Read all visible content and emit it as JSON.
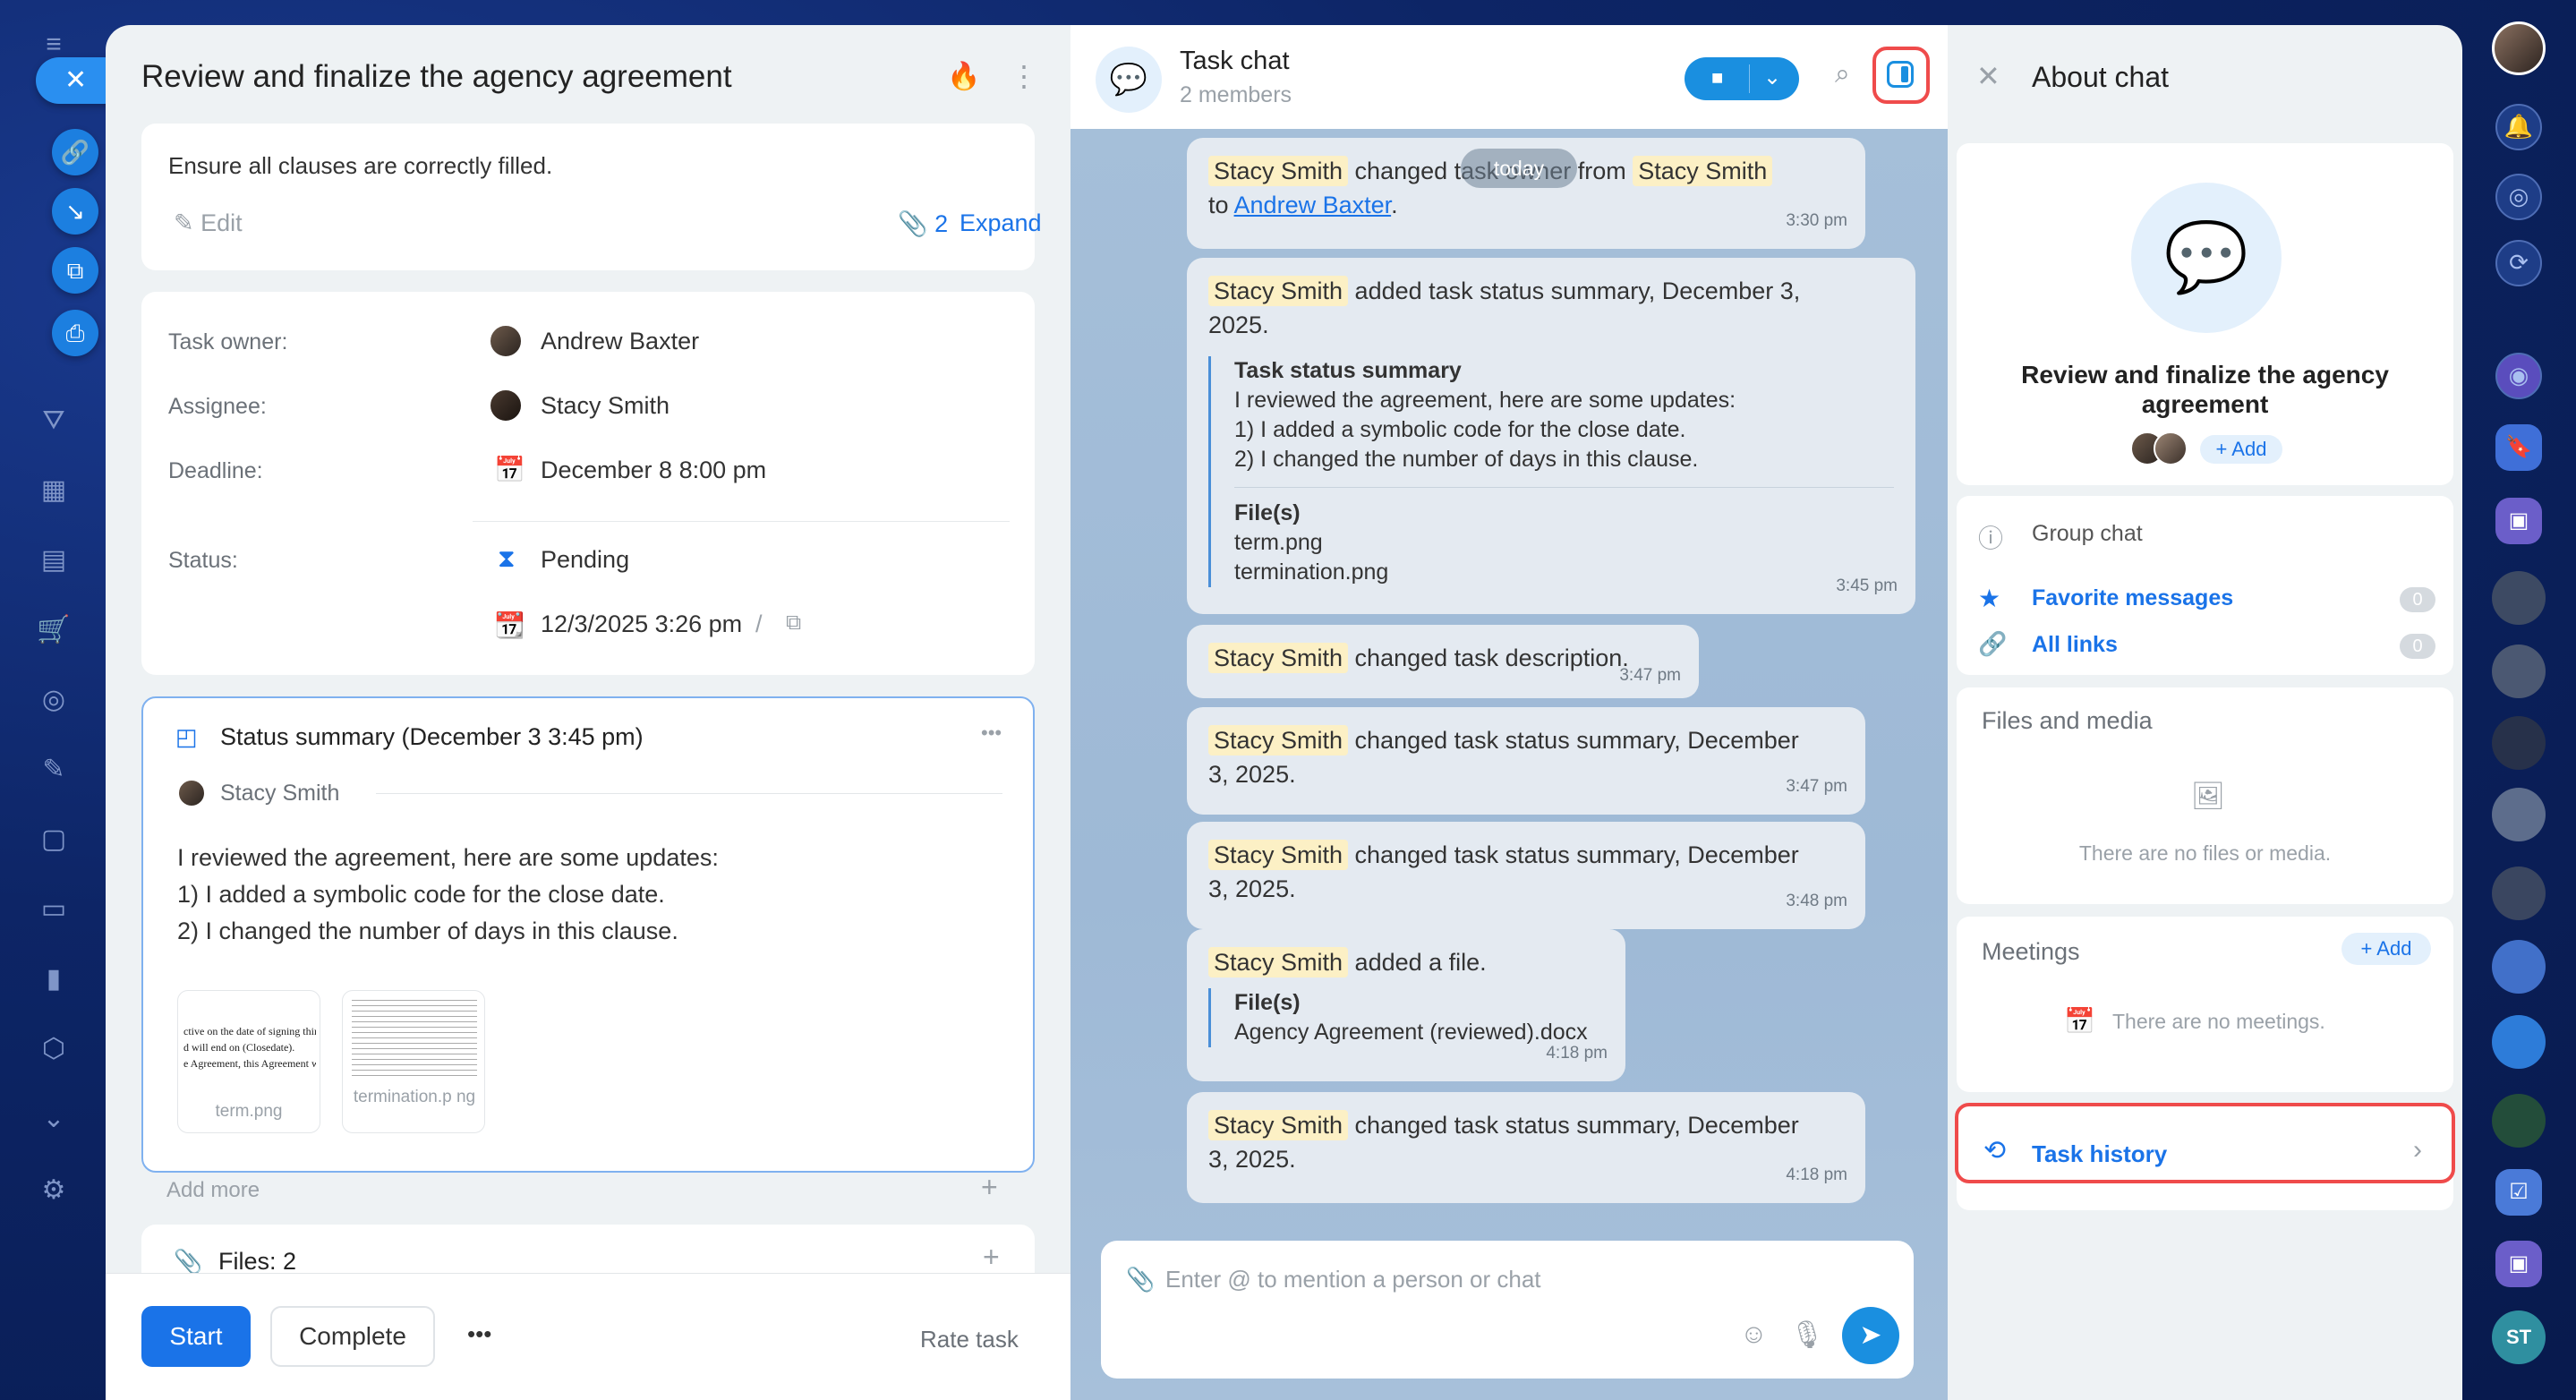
{
  "task": {
    "title": "Review and finalize the agency agreement",
    "description": "Ensure all clauses are correctly filled.",
    "edit_label": "Edit",
    "attach_count": "2",
    "expand_label": "Expand",
    "owner_label": "Task owner:",
    "owner": "Andrew Baxter",
    "assignee_label": "Assignee:",
    "assignee": "Stacy Smith",
    "deadline_label": "Deadline:",
    "deadline": "December 8 8:00 pm",
    "status_label": "Status:",
    "status": "Pending",
    "started": "12/3/2025 3:26 pm",
    "started_sep": "/",
    "summary_title": "Status summary (December 3 3:45 pm)",
    "summary_author": "Stacy Smith",
    "summary_l1": "I reviewed the agreement, here are some updates:",
    "summary_l2": "1) I added a symbolic code for the close date.",
    "summary_l3": "2) I changed the number of days in this clause.",
    "thumb1_name": "term.png",
    "thumb2_name": "termination.p ng",
    "thumb1_text_l1": "ctive on the date of signing thir",
    "thumb1_text_l2": "d will end on (Closedate).",
    "thumb1_text_l3": "e Agreement, this Agreement w",
    "add_more": "Add more",
    "files_label": "Files: 2",
    "start_btn": "Start",
    "complete_btn": "Complete",
    "more_btn": "•••",
    "rate_task": "Rate task"
  },
  "chat": {
    "title": "Task chat",
    "members": "2 members",
    "date_chip": "today",
    "input_placeholder": "Enter @ to mention a person or chat",
    "m1": {
      "name1": "Stacy Smith",
      "text": " changed task owner from ",
      "name2": "Stacy Smith",
      "to": "to ",
      "link": "Andrew Baxter",
      "end": ".",
      "time": "3:30 pm"
    },
    "m2": {
      "name": "Stacy Smith",
      "text": " added task status summary, December 3,",
      "text2": "2025.",
      "q_title": "Task status summary",
      "q1": "I reviewed the agreement, here are some updates:",
      "q2": "1) I added a symbolic code for the close date.",
      "q3": "2) I changed the number of days in this clause.",
      "f_title": "File(s)",
      "f1": "term.png",
      "f2": "termination.png",
      "time": "3:45 pm"
    },
    "m3": {
      "name": "Stacy Smith",
      "text": " changed task description.",
      "time": "3:47 pm"
    },
    "m4": {
      "name": "Stacy Smith",
      "text": " changed task status summary, December",
      "text2": "3, 2025.",
      "time": "3:47 pm"
    },
    "m5": {
      "name": "Stacy Smith",
      "text": " changed task status summary, December",
      "text2": "3, 2025.",
      "time": "3:48 pm"
    },
    "m6": {
      "name": "Stacy Smith",
      "text": " added a file.",
      "f_title": "File(s)",
      "f1": "Agency Agreement (reviewed).docx",
      "time": "4:18 pm"
    },
    "m7": {
      "name": "Stacy Smith",
      "text": " changed task status summary, December",
      "text2": "3, 2025.",
      "time": "4:18 pm"
    }
  },
  "about": {
    "title": "About chat",
    "chat_name": "Review and finalize the agency agreement",
    "add_label": "+ Add",
    "group_chat": "Group chat",
    "favorites": "Favorite messages",
    "favorites_count": "0",
    "all_links": "All links",
    "links_count": "0",
    "files_media": "Files and media",
    "no_files": "There are no files or media.",
    "meetings": "Meetings",
    "meetings_add": "+ Add",
    "no_meetings": "There are no meetings.",
    "task_history": "Task history"
  },
  "right_sidebar": {
    "initials": "ST"
  },
  "colors": {
    "accent": "#1a73e8",
    "highlight": "#ef4b4b",
    "name_tag": "#fcf0c5"
  }
}
